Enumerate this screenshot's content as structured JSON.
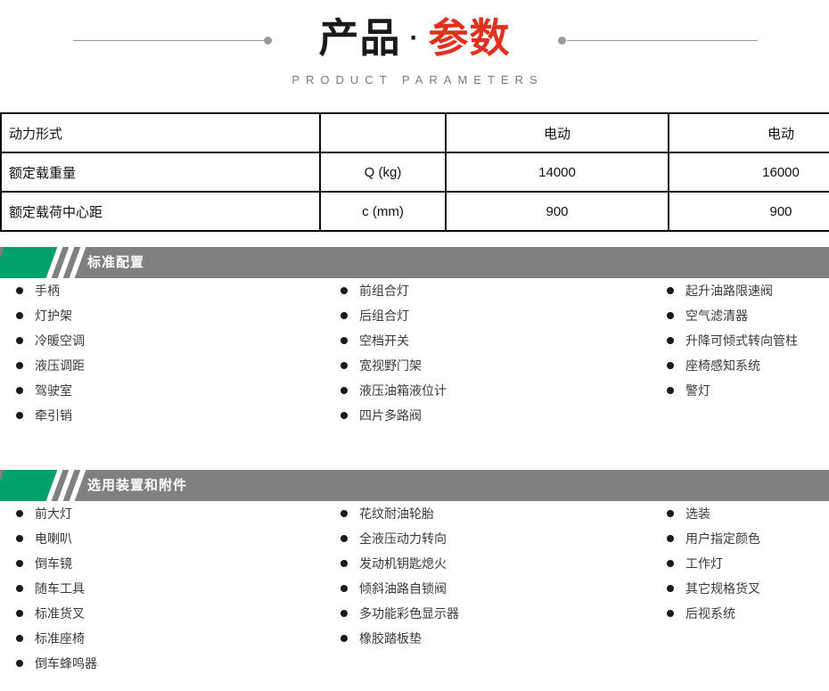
{
  "header": {
    "title_black": "产品",
    "title_separator": "·",
    "title_red": "参数",
    "subtitle": "PRODUCT PARAMETERS",
    "accent_red": "#e0301e",
    "line_color": "#9a9a9a"
  },
  "spec_table": {
    "columns": [
      "",
      "",
      "",
      ""
    ],
    "rows": [
      {
        "name": "动力形式",
        "symbol": "",
        "value1": "电动",
        "value2": "电动"
      },
      {
        "name": "额定载重量",
        "symbol": "Q (kg)",
        "value1": "14000",
        "value2": "16000"
      },
      {
        "name": "额定载荷中心距",
        "symbol": "c (mm)",
        "value1": "900",
        "value2": "900"
      }
    ]
  },
  "sections": [
    {
      "title": "标准配置",
      "accent_green": "#00a06b",
      "bar_gray": "#808080",
      "columns": [
        [
          "手柄",
          "灯护架",
          "冷暖空调",
          "液压调距",
          "驾驶室",
          "牵引销"
        ],
        [
          "前组合灯",
          "后组合灯",
          "空档开关",
          "宽视野门架",
          "液压油箱液位计",
          "四片多路阀"
        ],
        [
          "起升油路限速阀",
          "空气滤清器",
          "升降可倾式转向管柱",
          "座椅感知系统",
          "警灯"
        ]
      ]
    },
    {
      "title": "选用装置和附件",
      "accent_green": "#00a06b",
      "bar_gray": "#808080",
      "columns": [
        [
          "前大灯",
          "电喇叭",
          "倒车镜",
          "随车工具",
          "标准货叉",
          "标准座椅",
          "倒车蜂鸣器"
        ],
        [
          "花纹耐油轮胎",
          "全液压动力转向",
          "发动机钥匙熄火",
          "倾斜油路自锁阀",
          "多功能彩色显示器",
          "橡胶踏板垫"
        ],
        [
          "选装",
          "用户指定颜色",
          "工作灯",
          "其它规格货叉",
          "后视系统"
        ]
      ]
    }
  ]
}
